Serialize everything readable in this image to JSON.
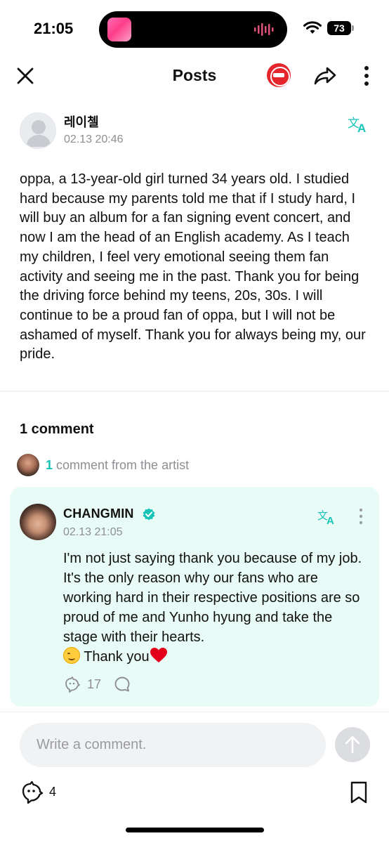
{
  "status_bar": {
    "time": "21:05",
    "battery": "73",
    "icons": [
      "now-playing-thumbnail",
      "audio-waveform-icon",
      "wifi-icon",
      "battery-icon"
    ]
  },
  "header": {
    "title": "Posts",
    "icons": [
      "close-icon",
      "community-logo",
      "share-icon",
      "more-vertical-icon"
    ]
  },
  "post": {
    "author": "레이첼",
    "timestamp": "02.13 20:46",
    "body": "oppa, a 13-year-old girl turned 34 years old. I studied hard because my parents told me that if I study hard, I will buy an album for a fan signing event concert, and now I am the head of an English academy. As I teach my children, I feel very emotional seeing them fan activity and seeing me in the past. Thank you for being the driving force behind my teens, 20s, 30s. I will continue to be a proud fan of oppa, but I will not be ashamed of myself. Thank you for always being my, our pride.",
    "like_count": "4"
  },
  "comments": {
    "heading": "1 comment",
    "artist_count": "1",
    "artist_label": " comment from the artist"
  },
  "artist_comment": {
    "name": "CHANGMIN",
    "timestamp": "02.13 21:05",
    "body_text": "I'm not just saying thank you because of my job. It's the only reason why our fans who are working hard in their respective positions are so proud of me and Yunho hyung and take the stage with their hearts.",
    "closing_text": "Thank you",
    "like_count": "17"
  },
  "composer": {
    "placeholder": "Write a comment."
  },
  "colors": {
    "accent": "#18c3b7",
    "card_background": "#e9fbf7",
    "community_logo": "#e5252c",
    "heart": "#e3001b"
  }
}
